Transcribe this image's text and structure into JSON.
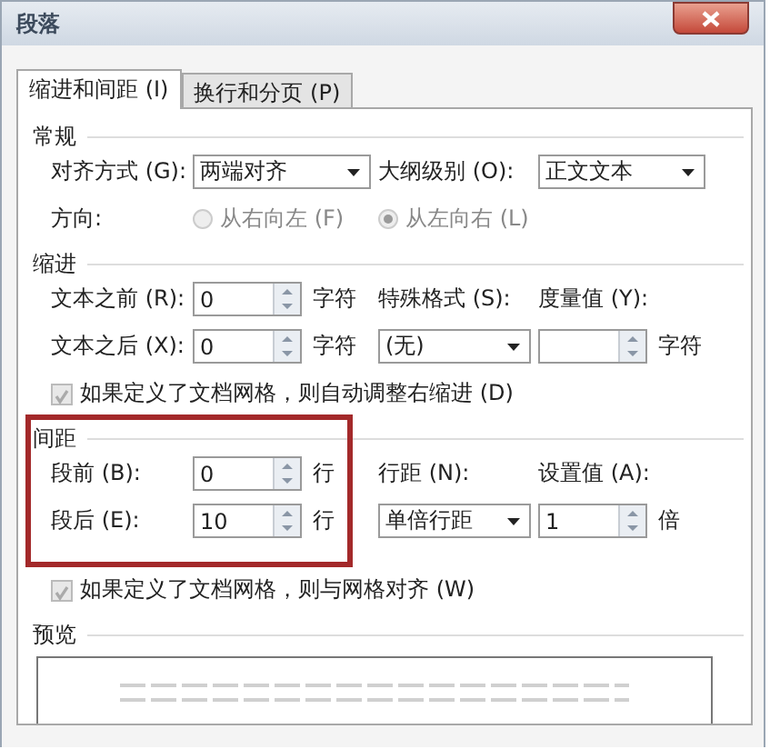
{
  "window": {
    "title": "段落"
  },
  "tabs": [
    {
      "label": "缩进和间距 (I)",
      "selected": true
    },
    {
      "label": "换行和分页 (P)",
      "selected": false
    }
  ],
  "sections": [
    {
      "title": "常规",
      "highlighted": false,
      "rows": [
        [
          {
            "kind": "label",
            "text": "对齐方式 (G):"
          },
          {
            "kind": "dropdown",
            "value": "两端对齐"
          },
          {
            "kind": "label",
            "text": "大纲级别 (O):"
          },
          {
            "kind": "dropdown",
            "value": "正文文本"
          }
        ],
        [
          {
            "kind": "label",
            "text": "方向:"
          },
          {
            "kind": "radio",
            "text": "从右向左 (F)",
            "selected": false,
            "disabled": true
          },
          {
            "kind": "radio",
            "text": "从左向右 (L)",
            "selected": true,
            "disabled": true
          }
        ]
      ]
    },
    {
      "title": "缩进",
      "highlighted": false,
      "rows": [
        [
          {
            "kind": "label",
            "text": "文本之前 (R):"
          },
          {
            "kind": "spin",
            "value": "0"
          },
          {
            "kind": "label",
            "text": "字符"
          },
          {
            "kind": "label",
            "text": "特殊格式 (S):"
          },
          {
            "kind": "label",
            "text": "度量值 (Y):"
          }
        ],
        [
          {
            "kind": "label",
            "text": "文本之后 (X):"
          },
          {
            "kind": "spin",
            "value": "0"
          },
          {
            "kind": "label",
            "text": "字符"
          },
          {
            "kind": "dropdown",
            "value": "(无)"
          },
          {
            "kind": "spin"
          },
          {
            "kind": "label",
            "text": "字符"
          }
        ],
        [
          {
            "kind": "checkbox",
            "text": "如果定义了文档网格，则自动调整右缩进 (D)",
            "checked": true,
            "disabled": true
          }
        ]
      ]
    },
    {
      "title": "间距",
      "highlighted": true,
      "rows": [
        [
          {
            "kind": "label",
            "text": "段前 (B):"
          },
          {
            "kind": "spin",
            "value": "0"
          },
          {
            "kind": "label",
            "text": "行"
          },
          {
            "kind": "label",
            "text": "行距 (N):"
          },
          {
            "kind": "label",
            "text": "设置值 (A):"
          }
        ],
        [
          {
            "kind": "label",
            "text": "段后 (E):"
          },
          {
            "kind": "spin",
            "value": "10"
          },
          {
            "kind": "label",
            "text": "行"
          },
          {
            "kind": "dropdown",
            "value": "单倍行距"
          },
          {
            "kind": "spin",
            "value": "1"
          },
          {
            "kind": "label",
            "text": "倍"
          }
        ],
        [
          {
            "kind": "checkbox",
            "text": "如果定义了文档网格，则与网格对齐 (W)",
            "checked": true,
            "disabled": true
          }
        ]
      ]
    },
    {
      "title": "预览",
      "highlighted": false,
      "rows": [
        [
          {
            "kind": "preview"
          }
        ]
      ]
    }
  ]
}
